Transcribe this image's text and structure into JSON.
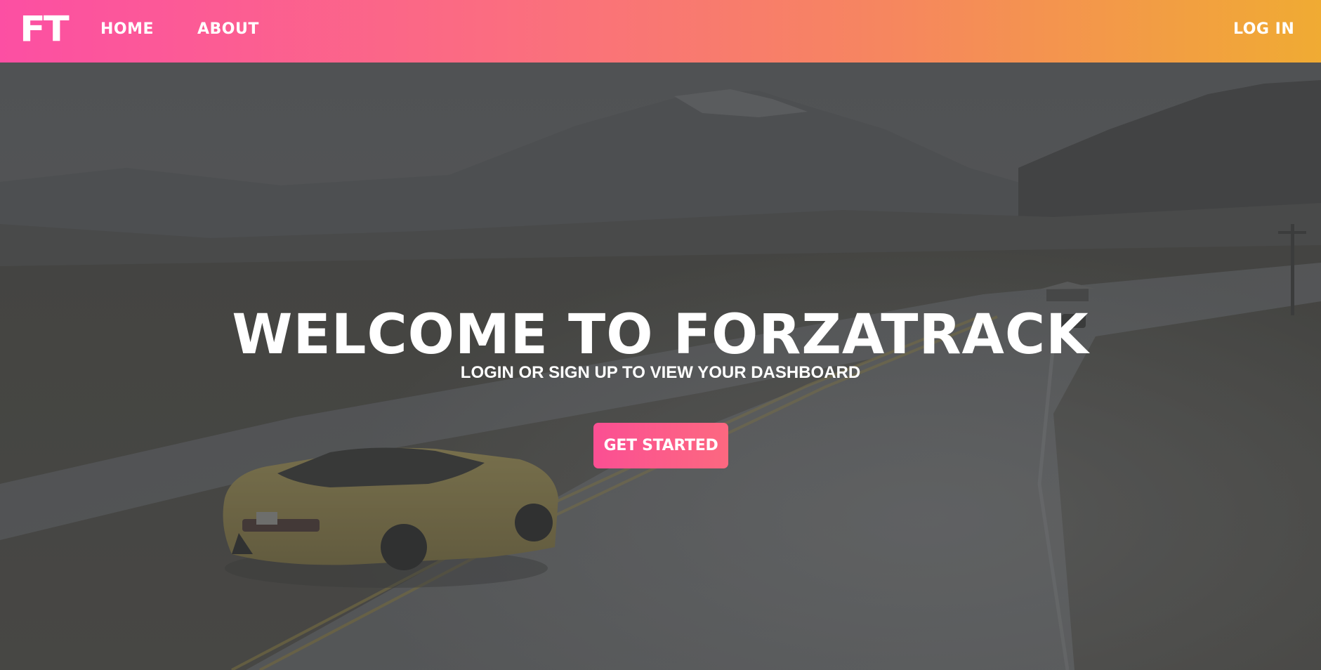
{
  "nav": {
    "logo": "FT",
    "home": "HOME",
    "about": "ABOUT",
    "login": "LOG IN"
  },
  "hero": {
    "title": "WELCOME TO FORZATRACK",
    "subtitle": "LOGIN OR SIGN UP TO VIEW YOUR DASHBOARD",
    "cta": "GET STARTED"
  },
  "colors": {
    "nav_gradient_start": "#fc4fa3",
    "nav_gradient_end": "#f0ab33",
    "cta_pink": "#fb4f93",
    "text": "#ffffff"
  }
}
